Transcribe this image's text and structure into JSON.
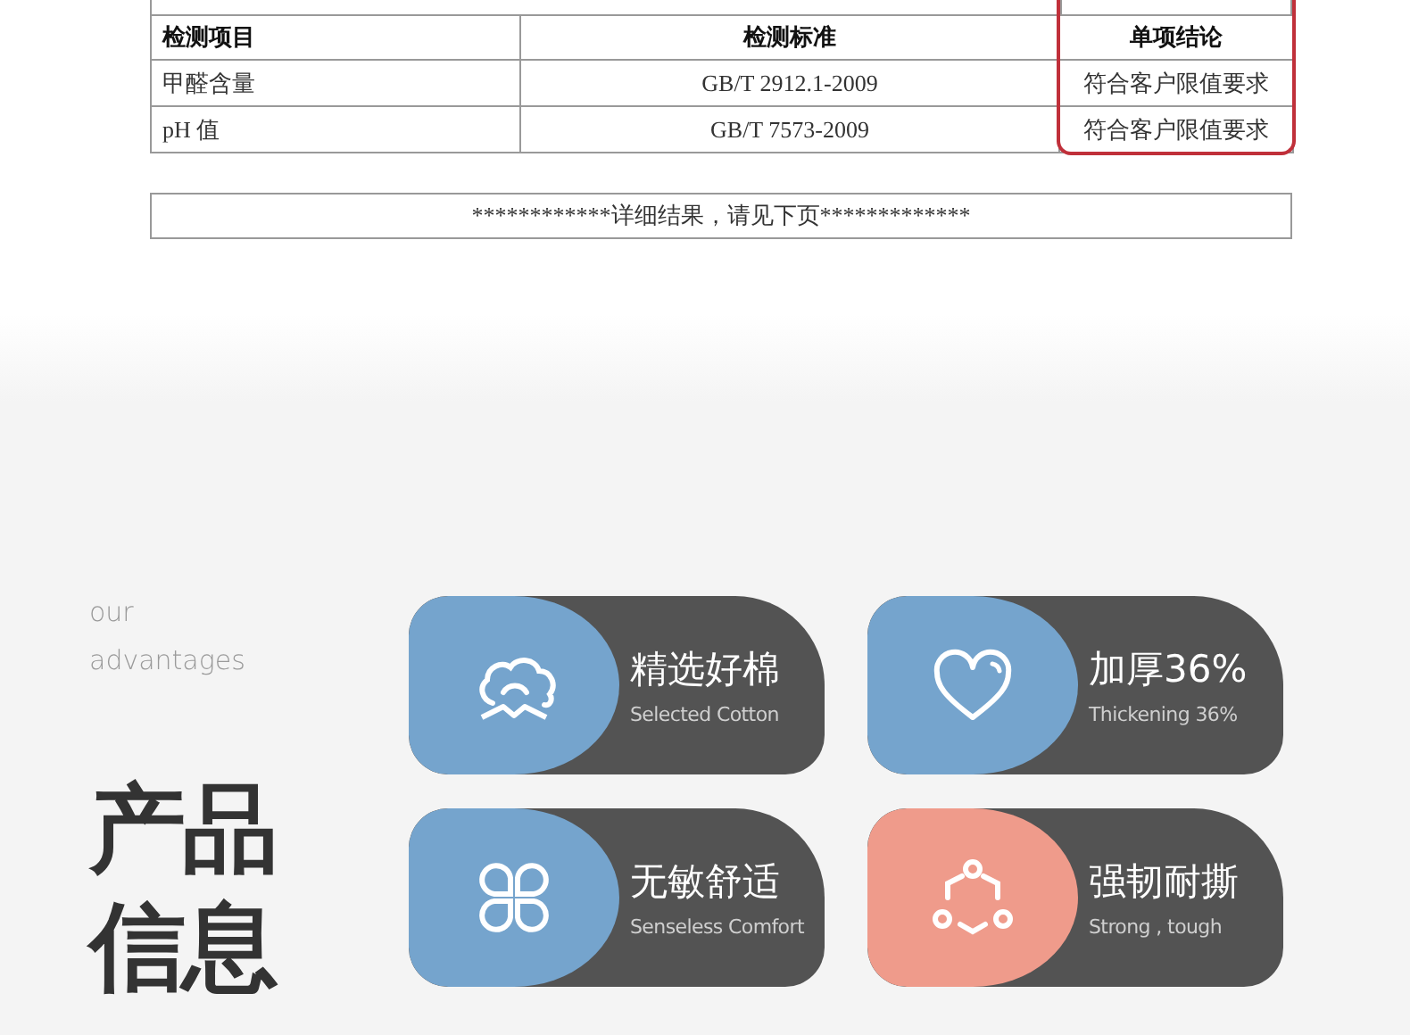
{
  "report_table": {
    "columns": [
      {
        "label": "检测项目",
        "highlighted": false
      },
      {
        "label": "检测标准",
        "highlighted": false
      },
      {
        "label": "单项结论",
        "highlighted": true
      }
    ],
    "rows": [
      [
        "甲醛含量",
        "GB/T 2912.1-2009",
        "符合客户限值要求"
      ],
      [
        "pH 值",
        "GB/T 7573-2009",
        "符合客户限值要求"
      ]
    ]
  },
  "notice": "************详细结果，请见下页*************",
  "advantages": {
    "subtitle": [
      "our",
      "advantages"
    ],
    "title": [
      "产品",
      "信息"
    ],
    "cards": [
      {
        "kind": "cotton",
        "title": "精选好棉",
        "caption": "Selected Cotton",
        "color": "#75a4cd"
      },
      {
        "kind": "heart",
        "title": "加厚36%",
        "caption": "Thickening 36%",
        "color": "#75a4cd"
      },
      {
        "kind": "clover",
        "title": "无敏舒适",
        "caption": "Senseless Comfort",
        "color": "#75a4cd"
      },
      {
        "kind": "ring",
        "title": "强韧耐撕",
        "caption": "Strong , tough",
        "color": "#ef9b8b"
      }
    ]
  }
}
